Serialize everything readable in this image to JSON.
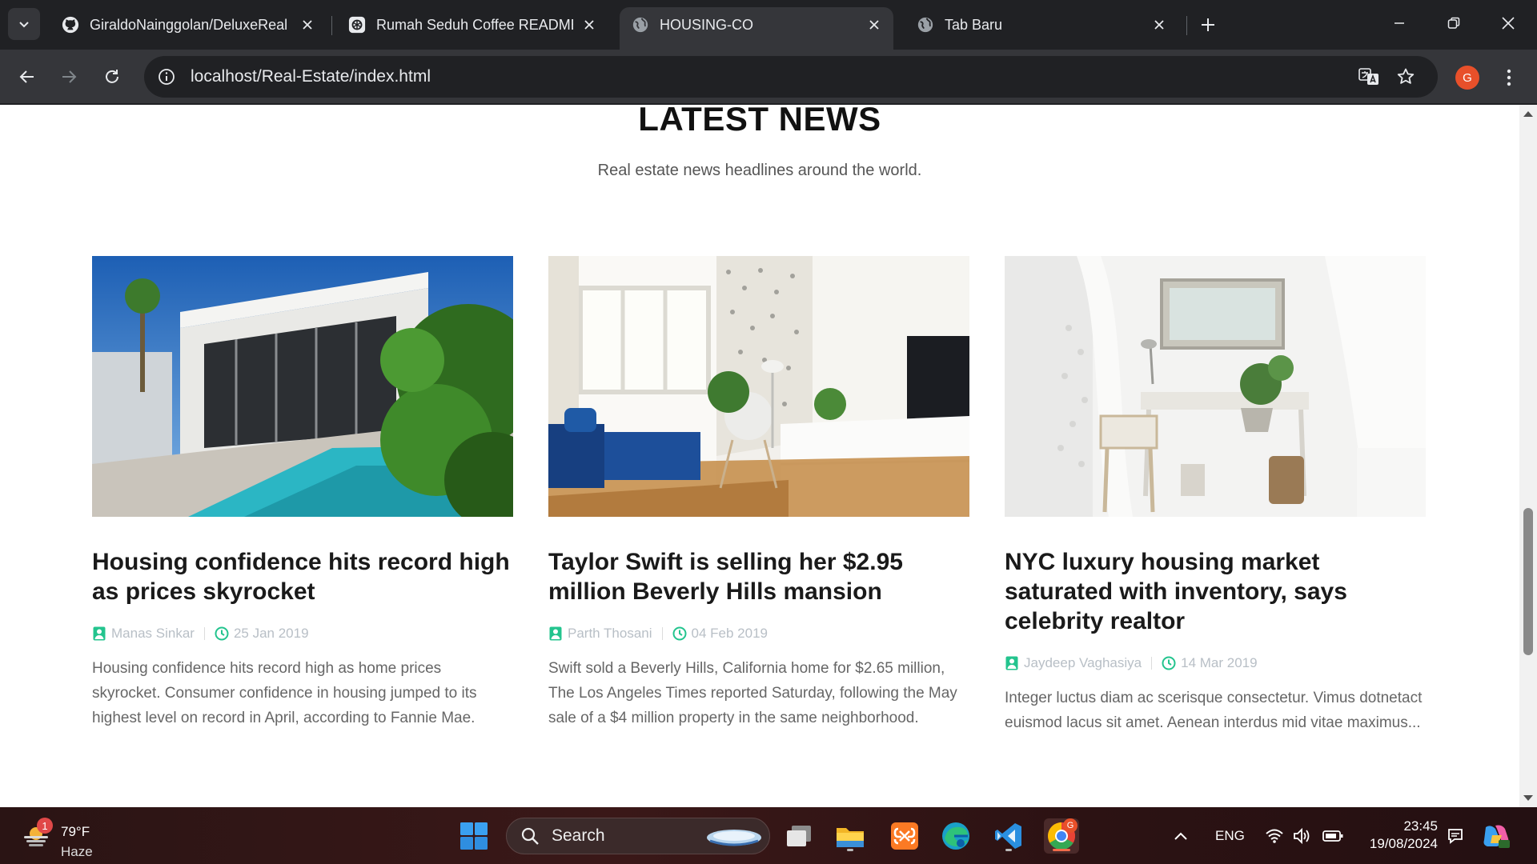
{
  "browser": {
    "tabs": [
      {
        "title": "GiraldoNainggolan/DeluxeReal",
        "favicon": "github-icon",
        "active": false
      },
      {
        "title": "Rumah Seduh Coffee README",
        "favicon": "chatgpt-icon",
        "active": false
      },
      {
        "title": "HOUSING-CO",
        "favicon": "globe-icon",
        "active": true
      },
      {
        "title": "Tab Baru",
        "favicon": "globe-icon",
        "active": false
      }
    ],
    "url": "localhost/Real-Estate/index.html",
    "profile_initial": "G"
  },
  "page": {
    "section_title": "LATEST NEWS",
    "section_subtitle": "Real estate news headlines around the world.",
    "accent_color": "#23c48e",
    "articles": [
      {
        "image": "modern-white-villa-with-pool",
        "headline": "Housing confidence hits record high as prices skyrocket",
        "author": "Manas Sinkar",
        "date": "25 Jan 2019",
        "excerpt": "Housing confidence hits record high as home prices skyrocket. Consumer confidence in housing jumped to its highest level on record in April, according to Fannie Mae."
      },
      {
        "image": "living-room-blue-sofa",
        "headline": "Taylor Swift is selling her $2.95 million Beverly Hills mansion",
        "author": "Parth Thosani",
        "date": "04 Feb 2019",
        "excerpt": "Swift sold a Beverly Hills, California home for $2.65 million, The Los Angeles Times reported Saturday, following the May sale of a $4 million property in the same neighborhood."
      },
      {
        "image": "white-bedroom-desk",
        "headline": "NYC luxury housing market saturated with inventory, says celebrity realtor",
        "author": "Jaydeep Vaghasiya",
        "date": "14 Mar 2019",
        "excerpt": "Integer luctus diam ac scerisque consectetur. Vimus dotnetact euismod lacus sit amet. Aenean interdus mid vitae maximus..."
      }
    ]
  },
  "taskbar": {
    "weather_temp": "79°F",
    "weather_condition": "Haze",
    "weather_badge": "1",
    "search_placeholder": "Search",
    "language": "ENG",
    "time": "23:45",
    "date": "19/08/2024",
    "chrome_badge": "G"
  }
}
